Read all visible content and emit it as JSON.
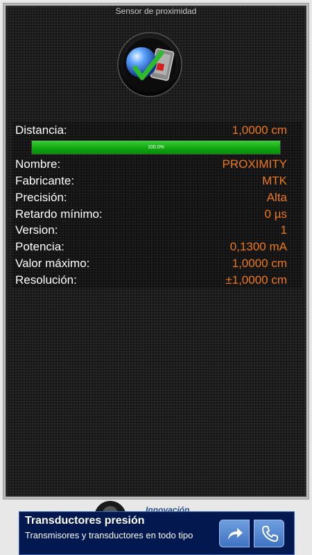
{
  "screen": {
    "title": "Sensor de proximidad",
    "icon": "proximity-sensor-icon"
  },
  "reading": {
    "label": "Distancia:",
    "value": "1,0000 cm",
    "progress_text": "100.0%",
    "progress_fraction": 1.0
  },
  "details": [
    {
      "label": "Nombre:",
      "value": "PROXIMITY"
    },
    {
      "label": "Fabricante:",
      "value": "MTK"
    },
    {
      "label": "Precisión:",
      "value": "Alta"
    },
    {
      "label": "Retardo mínimo:",
      "value": "0 µs"
    },
    {
      "label": "Version:",
      "value": "1"
    },
    {
      "label": "Potencia:",
      "value": "0,1300 mA"
    },
    {
      "label": "Valor máximo:",
      "value": "1,0000 cm"
    },
    {
      "label": "Resolución:",
      "value": "±1,0000 cm"
    }
  ],
  "colors": {
    "value_accent": "#f07818",
    "progress_fill": "#11a611",
    "ad_background": "#02184e"
  },
  "ad": {
    "logo_text": "Innovación",
    "headline": "Transductores presión",
    "subtext": "Transmisores y transductores en todo tipo",
    "share_icon": "share-arrow-icon",
    "call_icon": "phone-icon"
  }
}
